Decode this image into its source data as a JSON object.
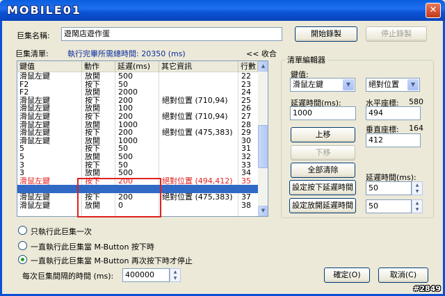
{
  "window": {
    "logo_text": "MOBILE01",
    "close_glyph": "✕"
  },
  "macro_name": {
    "label": "巨集名稱:",
    "value": "遊鬧店遊作蛋"
  },
  "buttons": {
    "start_record": "開始錄製",
    "stop_record": "停止錄製",
    "move_up": "上移",
    "move_down": "下移",
    "clear_all": "全部清除",
    "set_press_delay": "設定按下延遲時間",
    "set_release_delay": "設定放開延遲時間",
    "ok": "確定(O)",
    "cancel": "取消(C)"
  },
  "macro_list": {
    "label": "巨集清單:",
    "summary": "執行完畢所需總時間: 20350 (ms)",
    "collapse": "<< 收合",
    "columns": [
      "鍵值",
      "動作",
      "延遲(ms)",
      "其它資訊",
      "行數"
    ],
    "rows": [
      {
        "key": "滑鼠左鍵",
        "action": "放開",
        "delay": "500",
        "info": "",
        "line": "22"
      },
      {
        "key": "F2",
        "action": "按下",
        "delay": "50",
        "info": "",
        "line": "23"
      },
      {
        "key": "F2",
        "action": "放開",
        "delay": "2000",
        "info": "",
        "line": "24"
      },
      {
        "key": "滑鼠左鍵",
        "action": "按下",
        "delay": "200",
        "info": "絕對位置 (710,94)",
        "line": "25"
      },
      {
        "key": "滑鼠左鍵",
        "action": "放開",
        "delay": "100",
        "info": "",
        "line": "26"
      },
      {
        "key": "滑鼠左鍵",
        "action": "按下",
        "delay": "200",
        "info": "絕對位置 (710,94)",
        "line": "27"
      },
      {
        "key": "滑鼠左鍵",
        "action": "放開",
        "delay": "1000",
        "info": "",
        "line": "28"
      },
      {
        "key": "滑鼠左鍵",
        "action": "按下",
        "delay": "200",
        "info": "絕對位置 (475,383)",
        "line": "29"
      },
      {
        "key": "滑鼠左鍵",
        "action": "放開",
        "delay": "1000",
        "info": "",
        "line": "30"
      },
      {
        "key": "5",
        "action": "按下",
        "delay": "50",
        "info": "",
        "line": "31"
      },
      {
        "key": "5",
        "action": "放開",
        "delay": "500",
        "info": "",
        "line": "32"
      },
      {
        "key": "3",
        "action": "按下",
        "delay": "50",
        "info": "",
        "line": "33"
      },
      {
        "key": "3",
        "action": "放開",
        "delay": "500",
        "info": "",
        "line": "34"
      },
      {
        "key": "滑鼠左鍵",
        "action": "按下",
        "delay": "200",
        "info": "絕對位置 (494,412)",
        "line": "35",
        "style": "red"
      },
      {
        "key": "滑鼠左鍵",
        "action": "放開",
        "delay": "100",
        "info": "",
        "line": "36",
        "style": "sel"
      },
      {
        "key": "滑鼠左鍵",
        "action": "按下",
        "delay": "200",
        "info": "絕對位置 (475,383)",
        "line": "37"
      },
      {
        "key": "滑鼠左鍵",
        "action": "放開",
        "delay": "0",
        "info": "",
        "line": "38"
      }
    ]
  },
  "editor": {
    "title": "清單編輯器",
    "key_label": "鍵值:",
    "key_value": "滑鼠左鍵",
    "position_mode": "絕對位置",
    "delay_label": "延遲時間(ms):",
    "delay_value": "1000",
    "x_label": "水平座標:",
    "x_current": "580",
    "x_value": "494",
    "y_label": "垂直座標:",
    "y_current": "164",
    "y_value": "412",
    "delay2_label": "延遲時間(ms):",
    "press_delay_value": "50",
    "release_delay_value": "50"
  },
  "run_options": {
    "options": [
      "只執行此巨集一次",
      "一直執行此巨集當 M-Button 按下時",
      "一直執行此巨集當 M-Button 再次按下時才停止"
    ],
    "selected_index": 2,
    "interval_label": "每次巨集間隔的時間 (ms):",
    "interval_value": "400000"
  },
  "watermark": "#2849"
}
